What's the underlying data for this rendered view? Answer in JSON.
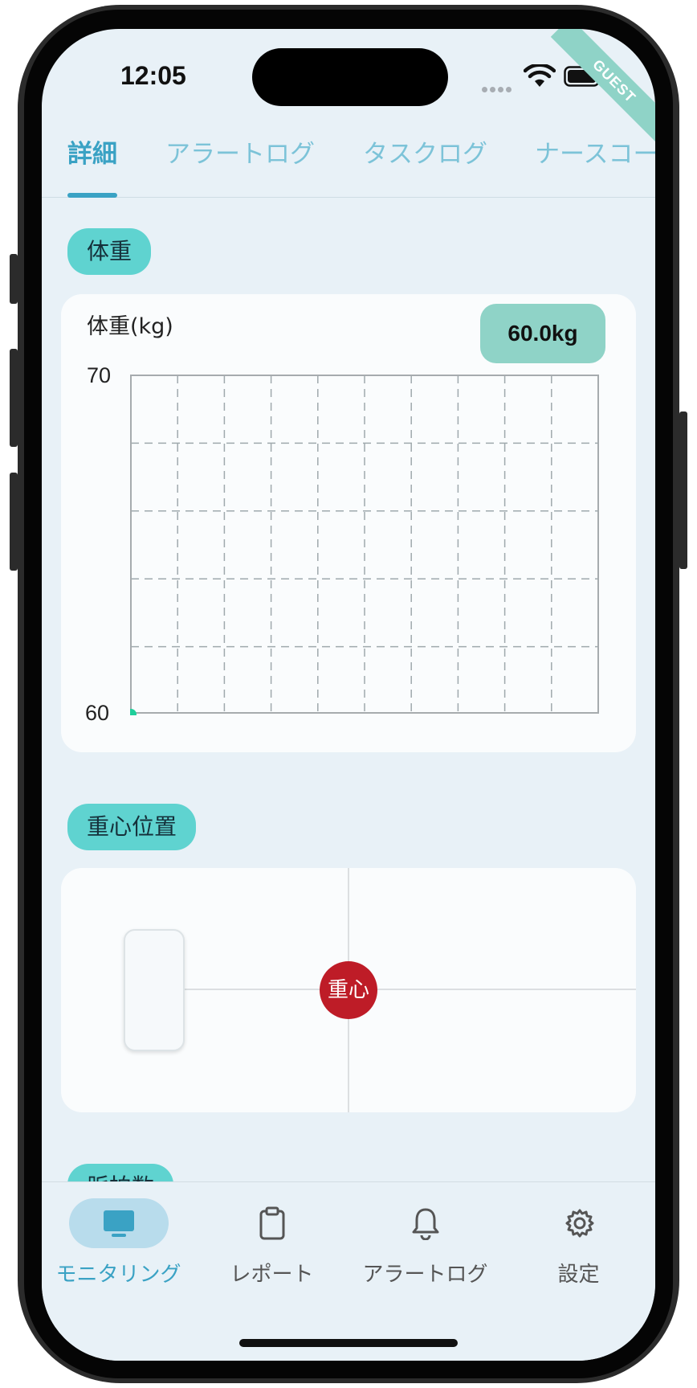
{
  "status_bar": {
    "time": "12:05",
    "ribbon": "GUEST"
  },
  "tabs": [
    {
      "label": "詳細",
      "active": true
    },
    {
      "label": "アラートログ",
      "active": false
    },
    {
      "label": "タスクログ",
      "active": false
    },
    {
      "label": "ナースコール",
      "active": false
    }
  ],
  "weight_section": {
    "pill": "体重",
    "chart_title": "体重(kg)",
    "current_value": "60.0kg"
  },
  "chart_data": {
    "type": "line",
    "title": "",
    "ylabel": "体重(kg)",
    "ylim": [
      60,
      70
    ],
    "yticks": [
      "70",
      "60"
    ],
    "x": [
      0
    ],
    "values": [
      60
    ],
    "grid": true,
    "point_color": "#1ecf9b"
  },
  "cog_section": {
    "pill": "重心位置",
    "marker_label": "重心"
  },
  "next_section": {
    "pill": "脈拍数"
  },
  "bottom_nav": [
    {
      "label": "モニタリング",
      "icon": "monitor-icon",
      "active": true
    },
    {
      "label": "レポート",
      "icon": "clipboard-icon",
      "active": false
    },
    {
      "label": "アラートログ",
      "icon": "bell-icon",
      "active": false
    },
    {
      "label": "設定",
      "icon": "gear-icon",
      "active": false
    }
  ],
  "colors": {
    "accent": "#3aa2c4",
    "pill": "#5fd3d0",
    "badge": "#8fd3c7",
    "cog_marker": "#be1c27"
  }
}
